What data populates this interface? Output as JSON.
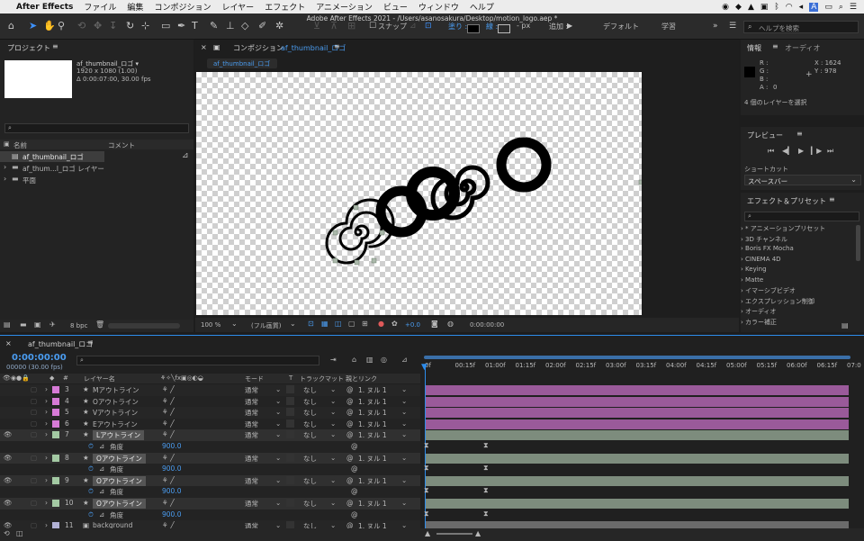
{
  "menubar": {
    "apple": "",
    "app": "After Effects",
    "items": [
      "ファイル",
      "編集",
      "コンポジション",
      "レイヤー",
      "エフェクト",
      "アニメーション",
      "ビュー",
      "ウィンドウ",
      "ヘルプ"
    ]
  },
  "window_title": "Adobe After Effects 2021 - /Users/asanosakura/Desktop/motion_logo.aep *",
  "toolbar": {
    "snap_label": "スナップ",
    "fill_label": "塗り :",
    "stroke_label": "線 :",
    "stroke_value": "-",
    "stroke_unit": "- px",
    "add_label": "追加 :",
    "workspaces": [
      "デフォルト",
      "学習"
    ],
    "search_placeholder": "ヘルプを検索"
  },
  "project": {
    "title": "プロジェクト",
    "comp_name": "af_thumbnail_ロゴ ▾",
    "resolution": "1920 x 1080 (1.00)",
    "duration": "Δ 0:00:07:00, 30.00 fps",
    "col_name": "名前",
    "col_comment": "コメント",
    "items": [
      "af_thumbnail_ロゴ",
      "af_thum...l_ロゴ レイヤー",
      "平面"
    ],
    "bpc": "8 bpc"
  },
  "composition": {
    "title": "コンポジション",
    "comp_name": "af_thumbnail_ロゴ",
    "tab": "af_thumbnail_ロゴ",
    "zoom": "100 %",
    "quality": "(フル画質)",
    "exposure": "+0.0",
    "timecode": "0:00:00:00"
  },
  "info": {
    "title": "情報",
    "tab2": "オーディオ",
    "r": "R :",
    "g": "G :",
    "b": "B :",
    "a": "A :",
    "a_value": "0",
    "x": "X : 1624",
    "y": "Y : 978",
    "status": "4 個のレイヤーを選択"
  },
  "preview": {
    "title": "プレビュー",
    "shortcut_label": "ショートカット",
    "shortcut_value": "スペースバー"
  },
  "effects": {
    "title": "エフェクト＆プリセット",
    "items": [
      "* アニメーションプリセット",
      "3D チャンネル",
      "Boris FX Mocha",
      "CINEMA 4D",
      "Keying",
      "Matte",
      "イマーシブビデオ",
      "エクスプレッション制御",
      "オーディオ",
      "カラー補正"
    ]
  },
  "timeline": {
    "tab": "af_thumbnail_ロゴ",
    "timecode": "0:00:00:00",
    "fps_text": "00000 (30.00 fps)",
    "col_layer": "レイヤー名",
    "col_mode": "モード",
    "col_t": "T",
    "col_trackmatte": "トラックマット",
    "col_parent": "親とリンク",
    "ruler": [
      "0f",
      "00:15f",
      "01:00f",
      "01:15f",
      "02:00f",
      "02:15f",
      "03:00f",
      "03:15f",
      "04:00f",
      "04:15f",
      "05:00f",
      "05:15f",
      "06:00f",
      "06:15f",
      "07:0"
    ],
    "layers": [
      {
        "num": "3",
        "name": "Mアウトライン",
        "mode": "通常",
        "matte": "なし",
        "parent": "1. ヌル 1",
        "color": "#d67ad6",
        "kind": "layer"
      },
      {
        "num": "4",
        "name": "Oアウトライン",
        "mode": "通常",
        "matte": "なし",
        "parent": "1. ヌル 1",
        "color": "#d67ad6",
        "kind": "layer"
      },
      {
        "num": "5",
        "name": "Vアウトライン",
        "mode": "通常",
        "matte": "なし",
        "parent": "1. ヌル 1",
        "color": "#d67ad6",
        "kind": "layer"
      },
      {
        "num": "6",
        "name": "Eアウトライン",
        "mode": "通常",
        "matte": "なし",
        "parent": "1. ヌル 1",
        "color": "#d67ad6",
        "kind": "layer"
      },
      {
        "num": "7",
        "name": "Lアウトライン",
        "mode": "通常",
        "matte": "なし",
        "parent": "1. ヌル 1",
        "color": "#a3c9a3",
        "kind": "selected"
      },
      {
        "name": "角度",
        "value": "900.0",
        "kind": "prop"
      },
      {
        "num": "8",
        "name": "Oアウトライン",
        "mode": "通常",
        "matte": "なし",
        "parent": "1. ヌル 1",
        "color": "#a3c9a3",
        "kind": "selected"
      },
      {
        "name": "角度",
        "value": "900.0",
        "kind": "prop"
      },
      {
        "num": "9",
        "name": "Oアウトライン",
        "mode": "通常",
        "matte": "なし",
        "parent": "1. ヌル 1",
        "color": "#a3c9a3",
        "kind": "selected"
      },
      {
        "name": "角度",
        "value": "900.0",
        "kind": "prop"
      },
      {
        "num": "10",
        "name": "Oアウトライン",
        "mode": "通常",
        "matte": "なし",
        "parent": "1. ヌル 1",
        "color": "#a3c9a3",
        "kind": "selected"
      },
      {
        "name": "角度",
        "value": "900.0",
        "kind": "prop"
      },
      {
        "num": "11",
        "name": "background",
        "mode": "通常",
        "matte": "なし",
        "parent": "1. ヌル 1",
        "color": "#b3b3d6",
        "kind": "bg"
      }
    ]
  },
  "colors": {
    "accent": "#2d8ceb",
    "layer_pink": "#9a5a9a",
    "layer_green": "#7d8c7d",
    "bg_gray": "#6a6a6a"
  }
}
